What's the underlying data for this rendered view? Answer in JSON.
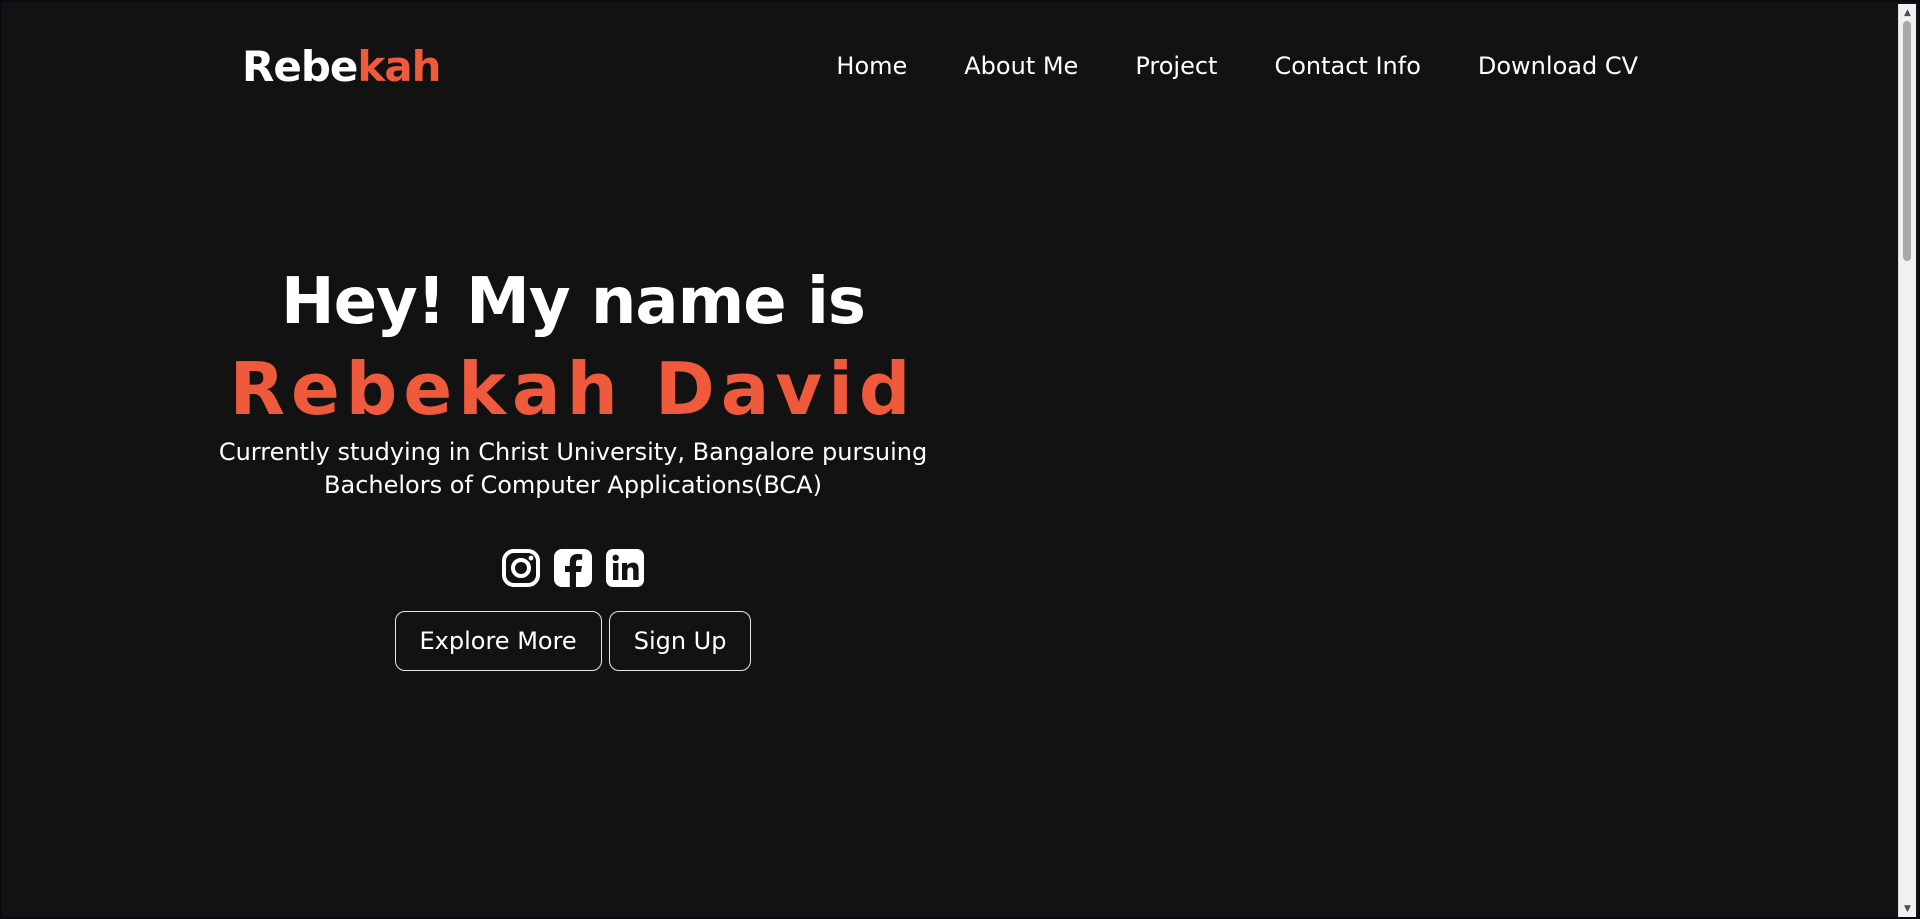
{
  "header": {
    "logo_primary": "Rebe",
    "logo_accent": "kah",
    "nav": [
      {
        "label": "Home"
      },
      {
        "label": "About Me"
      },
      {
        "label": "Project"
      },
      {
        "label": "Contact Info"
      },
      {
        "label": "Download CV"
      }
    ]
  },
  "hero": {
    "title": "Hey! My name is",
    "name": "Rebekah David",
    "description": "Currently studying in Christ University, Bangalore pursuing Bachelors of Computer Applications(BCA)",
    "socials": [
      {
        "icon": "instagram-icon"
      },
      {
        "icon": "facebook-icon"
      },
      {
        "icon": "linkedin-icon"
      }
    ],
    "buttons": {
      "explore": "Explore More",
      "signup": "Sign Up"
    }
  },
  "colors": {
    "background": "#121212",
    "accent": "#f05a3c",
    "text": "#ffffff"
  }
}
